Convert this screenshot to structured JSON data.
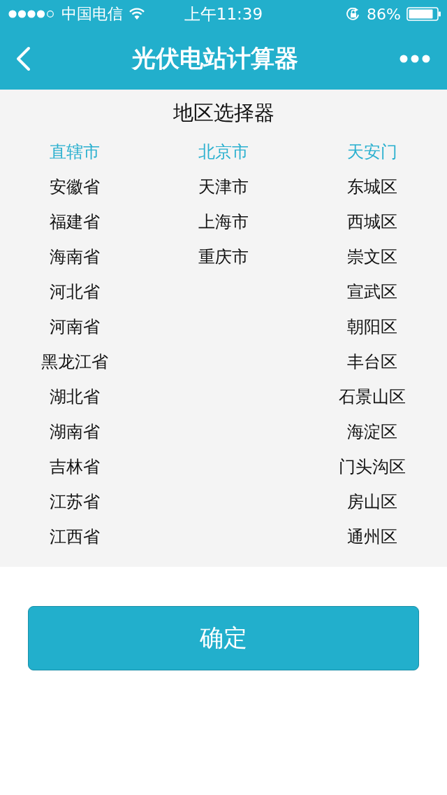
{
  "status_bar": {
    "carrier": "中国电信",
    "time": "上午11:39",
    "battery": "86%"
  },
  "nav": {
    "title": "光伏电站计算器"
  },
  "picker": {
    "title": "地区选择器",
    "columns": [
      {
        "items": [
          {
            "label": "直辖市",
            "selected": true
          },
          {
            "label": "安徽省",
            "selected": false
          },
          {
            "label": "福建省",
            "selected": false
          },
          {
            "label": "海南省",
            "selected": false
          },
          {
            "label": "河北省",
            "selected": false
          },
          {
            "label": "河南省",
            "selected": false
          },
          {
            "label": "黑龙江省",
            "selected": false
          },
          {
            "label": "湖北省",
            "selected": false
          },
          {
            "label": "湖南省",
            "selected": false
          },
          {
            "label": "吉林省",
            "selected": false
          },
          {
            "label": "江苏省",
            "selected": false
          },
          {
            "label": "江西省",
            "selected": false
          }
        ]
      },
      {
        "items": [
          {
            "label": "北京市",
            "selected": true
          },
          {
            "label": "天津市",
            "selected": false
          },
          {
            "label": "上海市",
            "selected": false
          },
          {
            "label": "重庆市",
            "selected": false
          }
        ]
      },
      {
        "items": [
          {
            "label": "天安门",
            "selected": true
          },
          {
            "label": "东城区",
            "selected": false
          },
          {
            "label": "西城区",
            "selected": false
          },
          {
            "label": "崇文区",
            "selected": false
          },
          {
            "label": "宣武区",
            "selected": false
          },
          {
            "label": "朝阳区",
            "selected": false
          },
          {
            "label": "丰台区",
            "selected": false
          },
          {
            "label": "石景山区",
            "selected": false
          },
          {
            "label": "海淀区",
            "selected": false
          },
          {
            "label": "门头沟区",
            "selected": false
          },
          {
            "label": "房山区",
            "selected": false
          },
          {
            "label": "通州区",
            "selected": false
          }
        ]
      }
    ]
  },
  "confirm_button": "确定"
}
